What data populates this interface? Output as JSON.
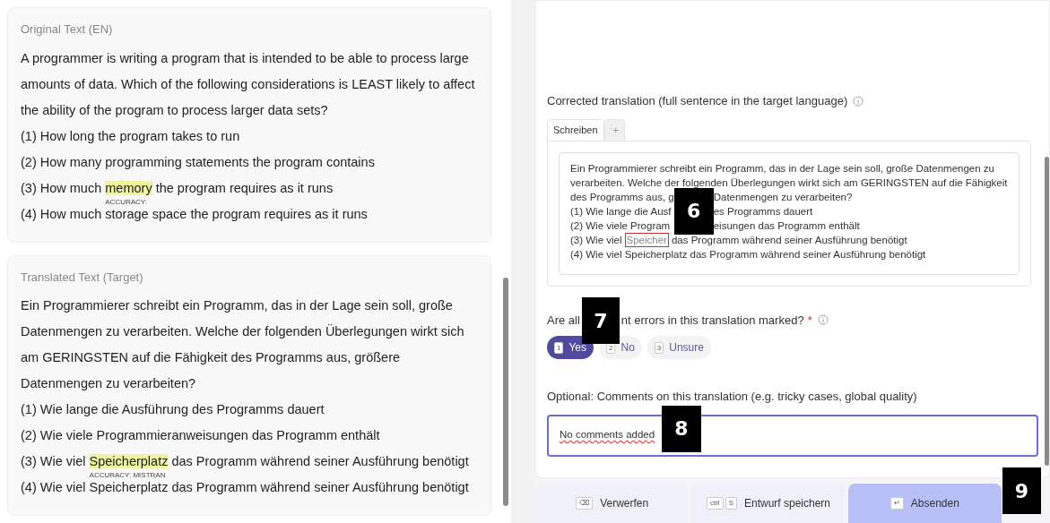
{
  "original": {
    "title": "Original Text (EN)",
    "lines": [
      {
        "kind": "plain",
        "text": "A programmer is writing a program that is intended to be able to process large amounts of data. Which of the following considerations is LEAST likely to affect the ability of the program to process larger data sets?"
      },
      {
        "kind": "plain",
        "text": "(1) How long the program takes to run"
      },
      {
        "kind": "plain",
        "text": "(2) How many programming statements the program contains"
      },
      {
        "kind": "marked",
        "before": "(3) How much ",
        "marked": "memory",
        "tag": "ACCURACY:",
        "after": " the program requires as it runs"
      },
      {
        "kind": "plain",
        "text": "(4) How much storage space the program requires as it runs"
      }
    ]
  },
  "translated": {
    "title": "Translated Text (Target)",
    "lines": [
      {
        "kind": "plain",
        "text": "Ein Programmierer schreibt ein Programm, das in der Lage sein soll, große Datenmengen zu verarbeiten. Welche der folgenden Überlegungen wirkt sich am GERINGSTEN auf die Fähigkeit des Programms aus, größere Datenmengen zu verarbeiten?"
      },
      {
        "kind": "plain",
        "text": "(1) Wie lange die Ausführung des Programms dauert"
      },
      {
        "kind": "plain",
        "text": "(2) Wie viele Programmieranweisungen das Programm enthält"
      },
      {
        "kind": "marked",
        "before": "(3) Wie viel ",
        "marked": "Speicherplatz",
        "tag": "ACCURACY: MISTRAN",
        "after": " das Programm während seiner Ausführung benötigt"
      },
      {
        "kind": "plain",
        "text": "(4) Wie viel Speicherplatz das Programm während seiner Ausführung benötigt"
      }
    ]
  },
  "corrected": {
    "label": "Corrected translation (full sentence in the target language)",
    "tabs": [
      {
        "label": "Schreiben",
        "selected": true
      },
      {
        "label": "ˑ+",
        "selected": false
      }
    ],
    "lines_top": [
      "Ein Programmierer schreibt ein Programm, das in der Lage sein soll, große Datenmengen zu",
      "verarbeiten. Welche der folgenden Überlegungen wirkt sich am GERINGSTEN auf die Fähigkeit"
    ],
    "covered_lines": [
      {
        "before": "des Programms aus, g",
        "after": "Datenmengen zu verarbeiten?"
      },
      {
        "before": "(1) Wie lange die Ausf",
        "after": "es Programms dauert"
      },
      {
        "before": "(2) Wie viele Program",
        "after": "eisungen das Programm enthält"
      }
    ],
    "marked_line": {
      "before": "(3) Wie viel",
      "marked": "Speicher",
      "after": "das Programm während seiner Ausführung benötigt"
    },
    "lines_bottom": [
      "(4) Wie viel Speicherplatz das Programm während seiner Ausführung benötigt"
    ]
  },
  "question": {
    "before": "Are all",
    "after": "nt errors in this translation marked?",
    "required": "*",
    "options": [
      {
        "key": "1",
        "label": "Yes",
        "selected": true
      },
      {
        "key": "2",
        "label": "No",
        "selected": false
      },
      {
        "key": "3",
        "label": "Unsure",
        "selected": false
      }
    ]
  },
  "comments": {
    "label": "Optional: Comments on this translation (e.g. tricky cases, global quality)",
    "value": "No comments added"
  },
  "actions": [
    {
      "keys": [
        "⌫"
      ],
      "label": "Verwerfen",
      "kind": "secondary"
    },
    {
      "keys": [
        "ctrl",
        "S"
      ],
      "label": "Entwurf speichern",
      "kind": "secondary"
    },
    {
      "keys": [
        "↵"
      ],
      "label": "Absenden",
      "kind": "primary"
    }
  ],
  "callouts": [
    {
      "label": "6"
    },
    {
      "label": "7"
    },
    {
      "label": "8"
    },
    {
      "label": "9"
    }
  ]
}
